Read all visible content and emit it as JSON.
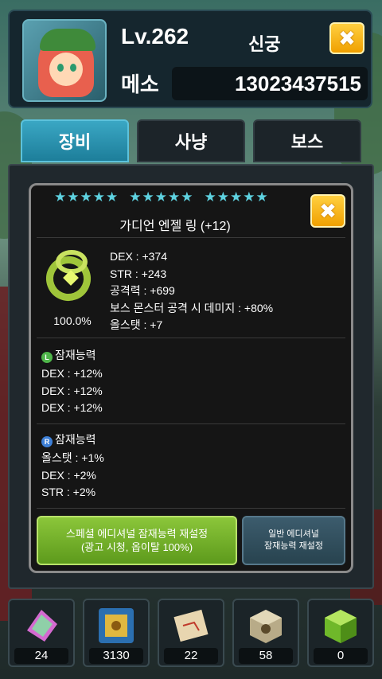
{
  "header": {
    "level": "Lv.262",
    "job": "신궁",
    "meso_label": "메소",
    "meso_value": "13023437515",
    "close_glyph": "✖"
  },
  "tabs": [
    {
      "label": "장비",
      "active": true
    },
    {
      "label": "사냥",
      "active": false
    },
    {
      "label": "보스",
      "active": false
    }
  ],
  "item": {
    "stars": 15,
    "name": "가디언 엔젤 링 (+12)",
    "percent": "100.0%",
    "stats": [
      "DEX : +374",
      "STR : +243",
      "공격력 : +699",
      "보스 몬스터 공격 시 데미지 : +80%",
      "올스탯 : +7"
    ],
    "potential": {
      "badge": "L",
      "title": "잠재능력",
      "lines": [
        "DEX : +12%",
        "DEX : +12%",
        "DEX : +12%"
      ]
    },
    "additional": {
      "badge": "R",
      "title": "잠재능력",
      "lines": [
        "올스탯 : +1%",
        "DEX : +2%",
        "STR : +2%"
      ]
    },
    "buttons": {
      "special_line1": "스페셜 에디셔널 잠재능력 재설정",
      "special_line2": "(광고 시청, 옵이탈 100%)",
      "normal_line1": "일반 에디셔널",
      "normal_line2": "잠재능력 재설정"
    }
  },
  "inventory": [
    {
      "icon": "cube-shard-icon",
      "count": "24"
    },
    {
      "icon": "golden-box-icon",
      "count": "3130"
    },
    {
      "icon": "scroll-map-icon",
      "count": "22"
    },
    {
      "icon": "silver-cube-icon",
      "count": "58"
    },
    {
      "icon": "green-cube-icon",
      "count": "0"
    }
  ],
  "colors": {
    "accent": "#3aa7c4",
    "star": "#5ed2e0",
    "close_button": "#f0a000",
    "special_button": "#8bc63a"
  }
}
